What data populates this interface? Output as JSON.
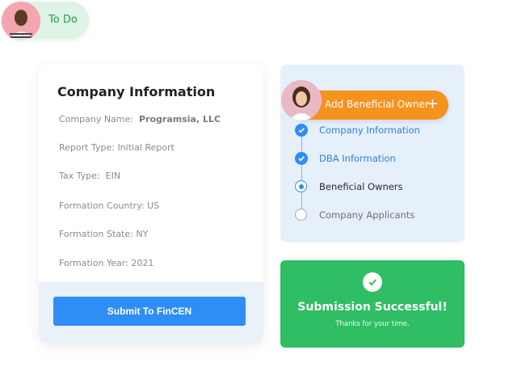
{
  "todo": {
    "label": "To Do"
  },
  "company": {
    "title": "Company Information",
    "fields": [
      {
        "label": "Company Name:",
        "value": "Programsia, LLC"
      },
      {
        "label": "Report Type:",
        "value": "Initial Report"
      },
      {
        "label": "Tax Type:",
        "value": "EIN"
      },
      {
        "label": "Formation Country:",
        "value": "US"
      },
      {
        "label": "Formation State:",
        "value": "NY"
      },
      {
        "label": "Formation Year:",
        "value": "2021"
      }
    ],
    "submit_label": "Submit To FinCEN"
  },
  "stepper": {
    "add_owner_label": "Add Beneficial Owner",
    "steps": [
      {
        "label": "Company Information",
        "state": "done"
      },
      {
        "label": "DBA Information",
        "state": "done"
      },
      {
        "label": "Beneficial Owners",
        "state": "current"
      },
      {
        "label": "Company Applicants",
        "state": "pending"
      }
    ]
  },
  "success": {
    "title": "Submission Successful!",
    "subtitle": "Thanks for your time."
  },
  "colors": {
    "accent": "#2e8ef5",
    "orange": "#f6921e",
    "green": "#2fbe63"
  }
}
